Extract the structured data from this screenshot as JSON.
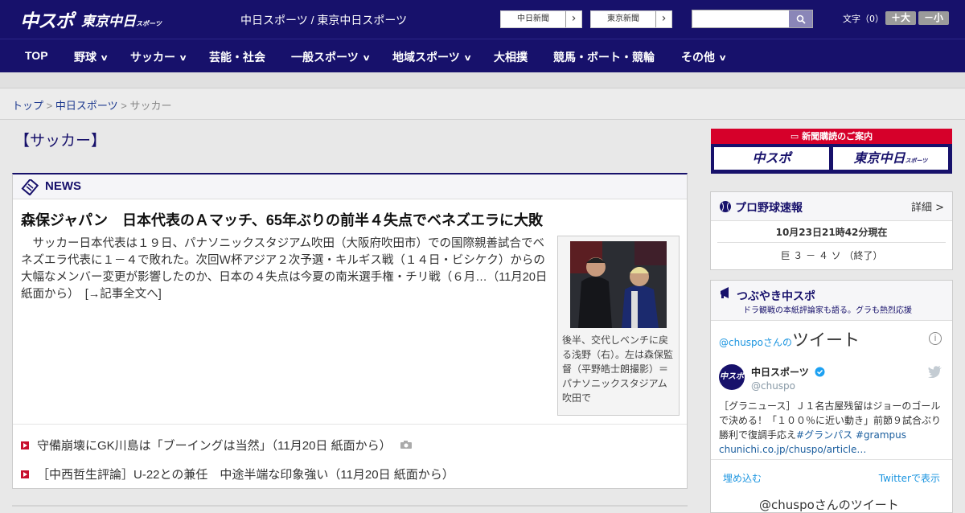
{
  "header": {
    "logo_main": "中スポ",
    "logo_tokyo": "東京中日",
    "logo_tokyo_suffix": "スポーツ",
    "site_name": "中日スポーツ / 東京中日スポーツ",
    "paper_links": [
      {
        "label": "中日新聞",
        "arrow": "›"
      },
      {
        "label": "東京新聞",
        "arrow": "›"
      }
    ],
    "search_placeholder": "",
    "font_size_label": "文字（0）",
    "font_larger": "＋大",
    "font_smaller": "－小"
  },
  "nav": {
    "items": [
      {
        "label": "TOP",
        "dropdown": false
      },
      {
        "label": "野球",
        "dropdown": true
      },
      {
        "label": "サッカー",
        "dropdown": true
      },
      {
        "label": "芸能・社会",
        "dropdown": false
      },
      {
        "label": "一般スポーツ",
        "dropdown": true
      },
      {
        "label": "地域スポーツ",
        "dropdown": true
      },
      {
        "label": "大相撲",
        "dropdown": false
      },
      {
        "label": "競馬・ボート・競輪",
        "dropdown": false
      },
      {
        "label": "その他",
        "dropdown": true
      }
    ],
    "dropdown_glyph": "∨"
  },
  "breadcrumb": {
    "items": [
      "トップ",
      "中日スポーツ"
    ],
    "current": "サッカー",
    "sep": ">"
  },
  "section_title": "【サッカー】",
  "news": {
    "header": "NEWS",
    "headline": "森保ジャパン　日本代表のＡマッチ、65年ぶりの前半４失点でベネズエラに大敗",
    "body": "　サッカー日本代表は１９日、パナソニックスタジアム吹田（大阪府吹田市）での国際親善試合でベネズエラ代表に１－４で敗れた。次回Ｗ杯アジア２次予選・キルギス戦（１４日・ビシケク）からの大幅なメンバー変更が影響したのか、日本の４失点は今夏の南米選手権・チリ戦（６月…（11月20日 紙面から）　[→記事全文へ]",
    "photo_caption": "後半、交代しベンチに戻る浅野（右）。左は森保監督（平野皓士朗撮影）＝パナソニックスタジアム吹田で",
    "list": [
      {
        "text": "守備崩壊にGK川島は「ブーイングは当然」（11月20日 紙面から）",
        "camera": true
      },
      {
        "text": "［中西哲生評論］U-22との兼任　中途半端な印象強い（11月20日 紙面から）",
        "camera": false
      }
    ]
  },
  "subscription": {
    "header": "新聞購読のご案内",
    "left": "中スポ",
    "right": "東京中日",
    "right_suffix": "スポーツ"
  },
  "scores": {
    "title": "プロ野球速報",
    "detail": "詳細 >",
    "time": "10月23日21時42分現在",
    "game": "巨 ３ － ４ ソ （終了）"
  },
  "tweets": {
    "title": "つぶやき中スポ",
    "subtitle": "ドラ観戦の本紙評論家も語る。グラも熱烈応援",
    "handle_prefix": "@chuspoさんの",
    "handle_word": "ツイート",
    "account_name": "中日スポーツ",
    "account_handle": "@chuspo",
    "avatar_text": "中スポ",
    "text_plain": "［グラニュース］Ｊ１名古屋残留はジョーのゴールで決める！「１００％に近い動き」前節９試合ぶり勝利で復調手応え",
    "text_tags": "#グランパス #grampus",
    "text_link": "chunichi.co.jp/chuspo/article…",
    "embed": "埋め込む",
    "view_on_twitter": "Twitterで表示",
    "more": "@chuspoさんのツイート"
  },
  "colors": {
    "brand_navy": "#17116b",
    "accent_red": "#c8102e",
    "link_blue": "#1b95e0"
  }
}
